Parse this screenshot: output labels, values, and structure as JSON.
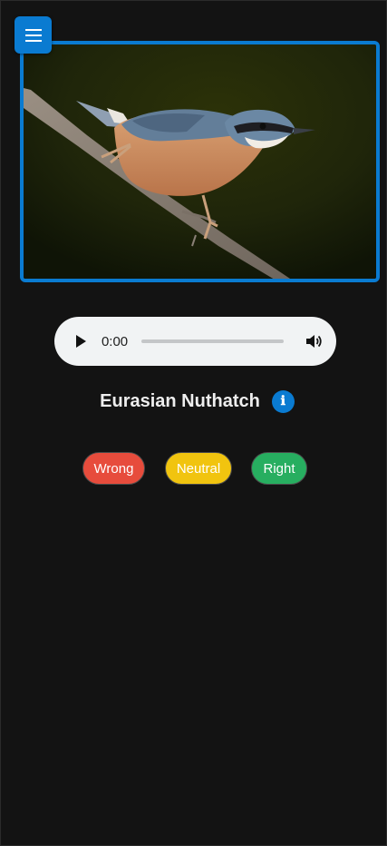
{
  "menu": {
    "icon": "hamburger-menu-icon"
  },
  "photo": {
    "subject": "bird-photo"
  },
  "audio": {
    "time": "0:00",
    "play_icon": "play-icon",
    "volume_icon": "volume-icon",
    "progress": 0
  },
  "species": {
    "name": "Eurasian Nuthatch",
    "info_icon": "info-icon",
    "info_glyph": "ℹ"
  },
  "rating": {
    "wrong": "Wrong",
    "neutral": "Neutral",
    "right": "Right"
  },
  "colors": {
    "accent": "#0a7bd1",
    "background": "#131313",
    "wrong": "#e74c3c",
    "neutral": "#f1c40f",
    "right": "#27ae60"
  }
}
